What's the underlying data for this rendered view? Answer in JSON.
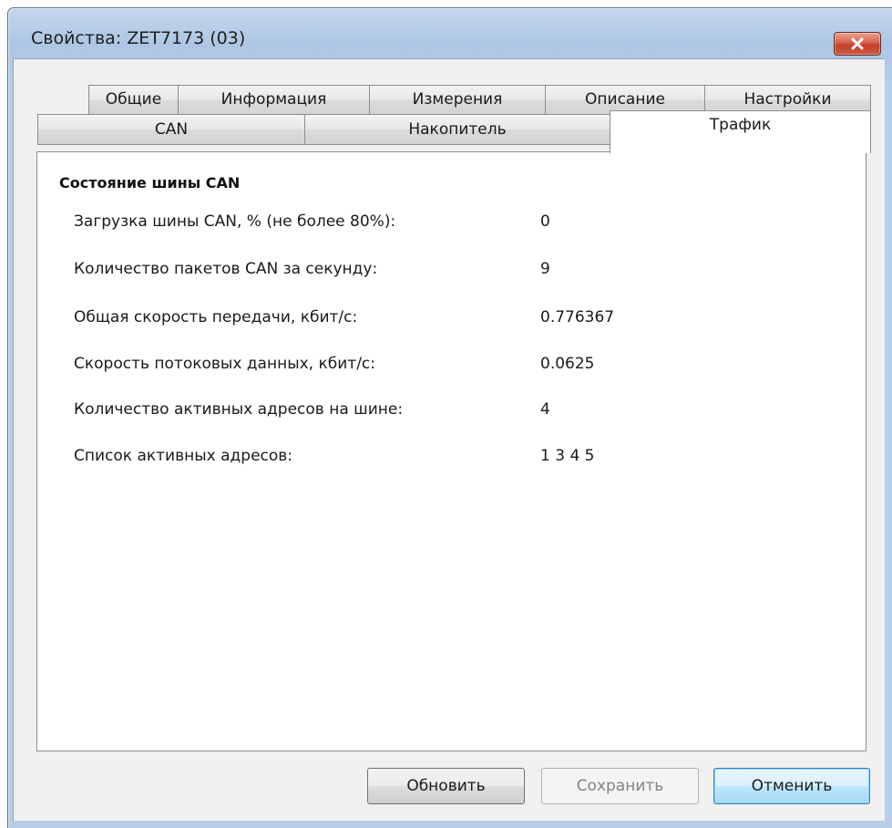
{
  "window": {
    "title": "Свойства: ZET7173 (03)"
  },
  "tabs": {
    "row_top": [
      {
        "label": "Общие"
      },
      {
        "label": "Информация"
      },
      {
        "label": "Измерения"
      },
      {
        "label": "Описание"
      },
      {
        "label": "Настройки"
      }
    ],
    "row_bottom": [
      {
        "label": "CAN"
      },
      {
        "label": "Накопитель"
      },
      {
        "label": "Трафик",
        "active": true
      }
    ]
  },
  "panel": {
    "section_title": "Состояние шины CAN",
    "rows": [
      {
        "label": "Загрузка шины CAN, % (не более 80%):",
        "value": "0"
      },
      {
        "label": "Количество пакетов CAN за секунду:",
        "value": "9"
      },
      {
        "label": "Общая скорость передачи, кбит/с:",
        "value": "0.776367"
      },
      {
        "label": "Скорость потоковых данных, кбит/с:",
        "value": "0.0625"
      },
      {
        "label": "Количество активных адресов на шине:",
        "value": "4"
      },
      {
        "label": "Список активных адресов:",
        "value": "1 3 4 5"
      }
    ]
  },
  "buttons": {
    "refresh": "Обновить",
    "save": "Сохранить",
    "cancel": "Отменить"
  },
  "colors": {
    "title_gradient_top": "#c4d8ee",
    "close_button": "#c4402a",
    "default_button_border": "#3c7fb1"
  }
}
